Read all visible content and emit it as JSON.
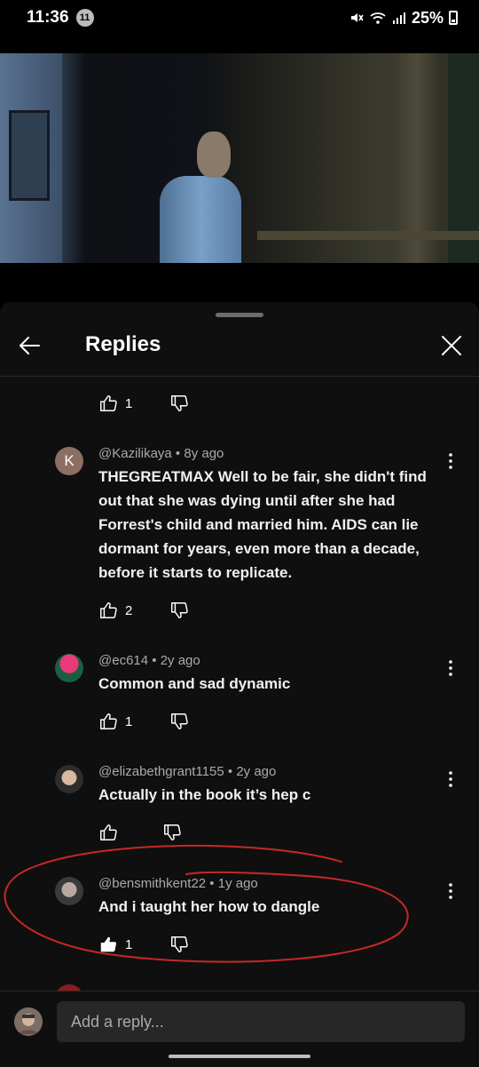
{
  "status_bar": {
    "time": "11:36",
    "notification_count": "11",
    "battery": "25%",
    "icons": [
      "mute-icon",
      "wifi-icon",
      "signal-icon",
      "battery-icon"
    ]
  },
  "video": {
    "description_icon": "video-player"
  },
  "sheet": {
    "title": "Replies",
    "back_icon": "back-arrow-icon",
    "close_icon": "close-icon"
  },
  "top_actions": {
    "like_count": "1"
  },
  "replies": [
    {
      "avatar_letter": "K",
      "avatar_color": "#8d6e63",
      "author": "@Kazilikaya",
      "time": "8y ago",
      "text": "THEGREATMAX Well to be fair, she didn't find out that she was dying until after she had Forrest's child and married him. AIDS can lie dormant for years, even more than a decade, before it starts to replicate.",
      "likes": "2"
    },
    {
      "author": "@ec614",
      "time": "2y ago",
      "text": "Common and sad dynamic",
      "likes": "1"
    },
    {
      "author": "@elizabethgrant1155",
      "time": "2y ago",
      "text": "Actually in the book it’s hep c",
      "likes": ""
    },
    {
      "author": "@bensmithkent22",
      "time": "1y ago",
      "text": "And i taught her how to dangle",
      "likes": "1",
      "liked": true
    }
  ],
  "composer": {
    "placeholder": "Add a reply..."
  },
  "colors": {
    "sheet_bg": "#0f0f0f",
    "input_bg": "#272727",
    "meta": "#aaaaaa",
    "annotation": "#c62828"
  }
}
